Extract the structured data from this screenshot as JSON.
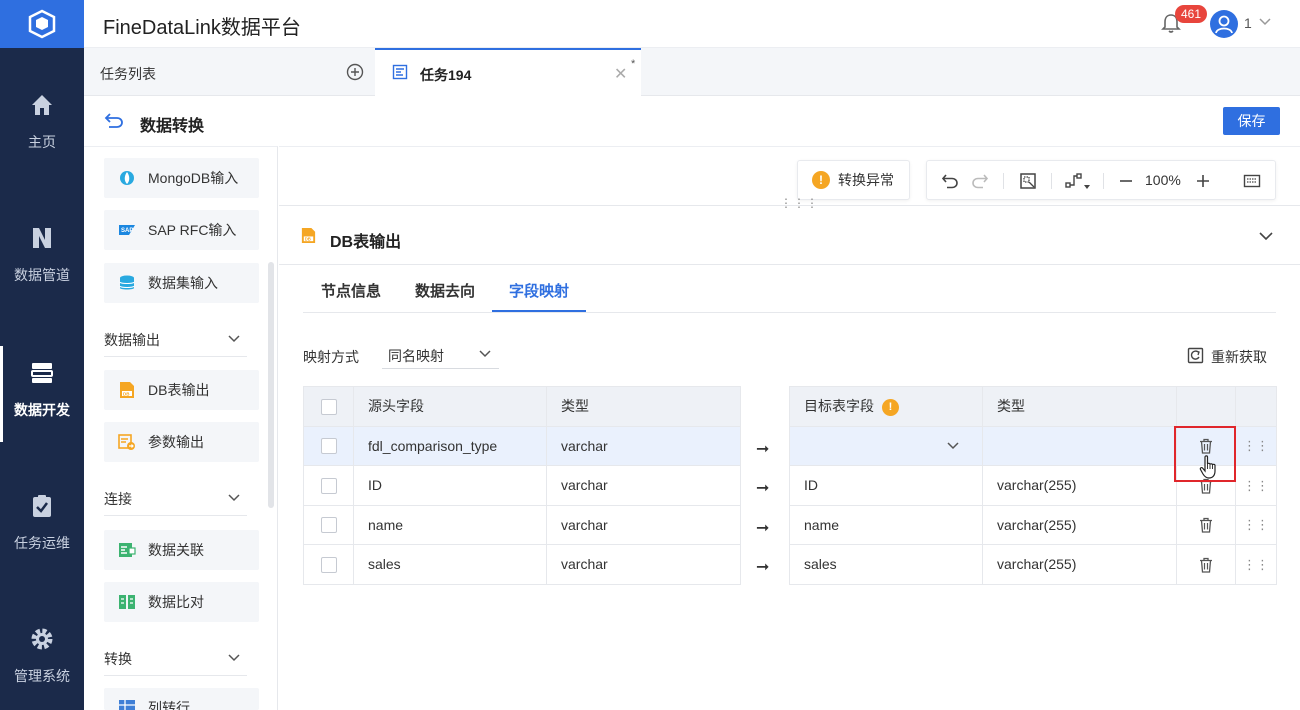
{
  "app": {
    "title": "FineDataLink数据平台",
    "notification_count": "461",
    "user_label": "1"
  },
  "nav": {
    "items": [
      {
        "label": "主页",
        "icon": "home-icon"
      },
      {
        "label": "数据管道",
        "icon": "pipeline-icon"
      },
      {
        "label": "数据开发",
        "icon": "develop-icon",
        "active": true
      },
      {
        "label": "任务运维",
        "icon": "ops-icon"
      },
      {
        "label": "管理系统",
        "icon": "gear-icon"
      }
    ]
  },
  "tabs": {
    "list_label": "任务列表",
    "active_label": "任务194",
    "modified_mark": "*"
  },
  "page": {
    "title": "数据转换",
    "save_label": "保存"
  },
  "components": {
    "items_top": [
      "MongoDB输入",
      "SAP RFC输入",
      "数据集输入"
    ],
    "group_output": "数据输出",
    "items_output": [
      "DB表输出",
      "参数输出"
    ],
    "group_connect": "连接",
    "items_connect": [
      "数据关联",
      "数据比对"
    ],
    "group_transform": "转换",
    "items_transform": [
      "列转行"
    ]
  },
  "canvas": {
    "warning_label": "转换异常",
    "zoom_level": "100%"
  },
  "node": {
    "title": "DB表输出",
    "tabs": [
      "节点信息",
      "数据去向",
      "字段映射"
    ],
    "active_tab": "字段映射",
    "mapping_label": "映射方式",
    "mapping_value": "同名映射",
    "refresh_label": "重新获取"
  },
  "source_table": {
    "headers": [
      "源头字段",
      "类型"
    ],
    "rows": [
      {
        "field": "fdl_comparison_type",
        "type": "varchar"
      },
      {
        "field": "ID",
        "type": "varchar"
      },
      {
        "field": "name",
        "type": "varchar"
      },
      {
        "field": "sales",
        "type": "varchar"
      }
    ]
  },
  "target_table": {
    "headers": [
      "目标表字段",
      "类型"
    ],
    "rows": [
      {
        "field": "",
        "type": ""
      },
      {
        "field": "ID",
        "type": "varchar(255)"
      },
      {
        "field": "name",
        "type": "varchar(255)"
      },
      {
        "field": "sales",
        "type": "varchar(255)"
      }
    ]
  },
  "colors": {
    "accent": "#2f6fe0",
    "nav_bg": "#1b2a4a",
    "warning": "#f5a623",
    "highlight_box": "#e0262b",
    "badge": "#e8453c"
  }
}
